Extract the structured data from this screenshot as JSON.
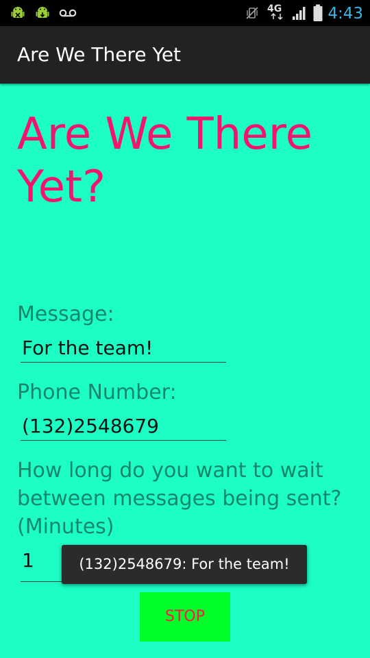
{
  "status_bar": {
    "time": "4:43",
    "network_label": "4G",
    "time_color": "#33b5e5",
    "left_icons": [
      "android-debug-icon",
      "android-update-icon",
      "voicemail-icon"
    ],
    "right_icons": [
      "vibrate-mute-icon",
      "4g-lte-icon",
      "signal-icon",
      "battery-icon"
    ]
  },
  "action_bar": {
    "title": "Are We There Yet"
  },
  "main": {
    "heading": "Are We There Yet?",
    "message_label": "Message:",
    "message_value": "For the team!",
    "phone_label": "Phone Number:",
    "phone_value": "(132)2548679",
    "interval_label": "How long do you want to wait between messages being sent? (Minutes)",
    "interval_value": "1",
    "stop_button_label": "STOP"
  },
  "toast": {
    "text": "(132)2548679: For the team!"
  },
  "colors": {
    "background": "#1dfec5",
    "heading": "#f2156b",
    "label": "#15876b",
    "button_bg": "#00ff2a",
    "button_text": "#ff1744"
  }
}
